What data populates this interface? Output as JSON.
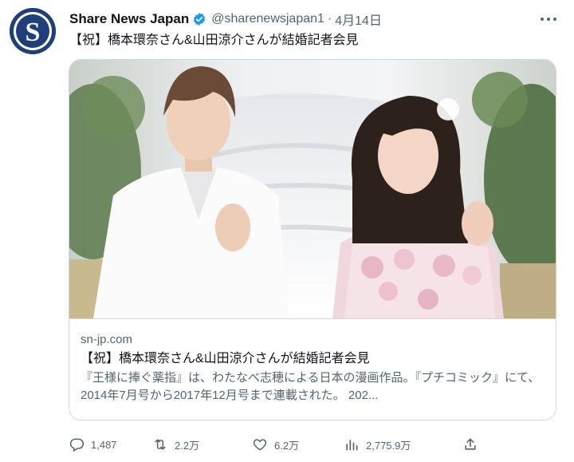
{
  "tweet": {
    "display_name": "Share News Japan",
    "handle": "@sharenewsjapan1",
    "separator": "·",
    "date": "4月14日",
    "text": "【祝】橋本環奈さん&山田涼介さんが結婚記者会見",
    "avatar_letter": "S",
    "avatar_color": "#1f3f7a",
    "verified_color": "#1d9bf0"
  },
  "card": {
    "domain": "sn-jp.com",
    "title": "【祝】橋本環奈さん&山田涼介さんが結婚記者会見",
    "description": "『王様に捧ぐ薬指』は、わたなべ志穂による日本の漫画作品。『プチコミック』にて、2014年7月号から2017年12月号まで連載された。 202..."
  },
  "actions": {
    "replies": "1,487",
    "reposts": "2.2万",
    "likes": "6.2万",
    "views": "2,775.9万"
  },
  "icons": {
    "more": "more-icon",
    "reply": "reply-icon",
    "repost": "repost-icon",
    "like": "heart-icon",
    "views": "views-icon",
    "share": "share-icon",
    "verified": "verified-badge-icon"
  }
}
